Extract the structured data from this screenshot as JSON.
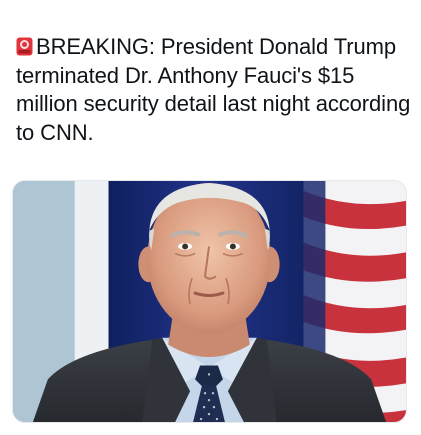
{
  "post": {
    "text_prefix": "BREAKING: President Donald",
    "text_rest": "Trump terminated Dr. Anthony Fauci's $15 million security detail last night according to CNN.",
    "siren_icon": "police-car-light-icon"
  },
  "media": {
    "kind": "photo",
    "icon_names": [
      "portrait-photo"
    ]
  },
  "colors": {
    "text": "#0f1419",
    "background": "#ffffff",
    "siren_red": "#e2323a",
    "flag_blue": "#1f2f78",
    "flag_red": "#c8323c"
  }
}
